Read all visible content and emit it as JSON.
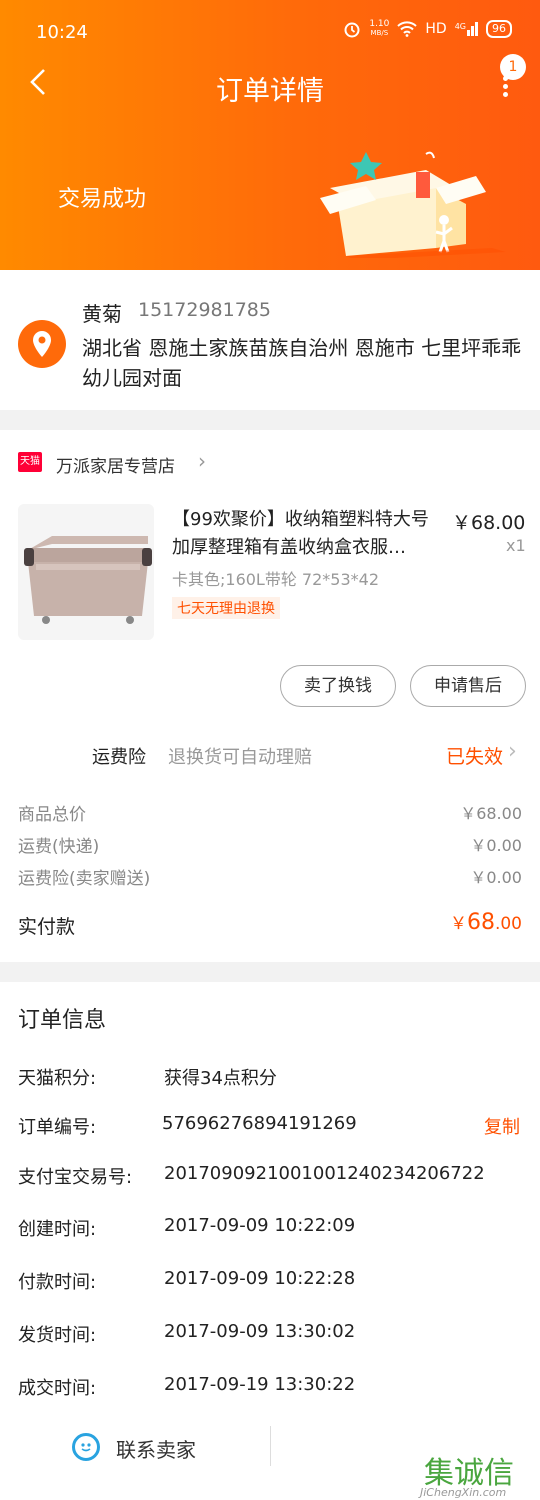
{
  "status_bar": {
    "time": "10:24",
    "speed": "1.10",
    "speed_unit": "MB/S",
    "hd": "HD",
    "signal": "4G",
    "battery": "96"
  },
  "nav": {
    "title": "订单详情",
    "badge": "1"
  },
  "header": {
    "status_text": "交易成功"
  },
  "address": {
    "name": "黄菊",
    "phone": "15172981785",
    "line": "湖北省 恩施土家族苗族自治州 恩施市 七里坪乖乖幼儿园对面"
  },
  "shop": {
    "logo_text": "天猫",
    "name": "万派家居专营店"
  },
  "product": {
    "title": "【99欢聚价】收纳箱塑料特大号加厚整理箱有盖收纳盒衣服…",
    "price": "￥68.00",
    "qty": "x1",
    "sku": "卡其色;160L带轮 72*53*42",
    "tag": "七天无理由退换"
  },
  "actions": {
    "sell": "卖了换钱",
    "after_sale": "申请售后"
  },
  "insurance": {
    "label": "运费险",
    "desc": "退换货可自动理赔",
    "status": "已失效"
  },
  "fees": [
    {
      "label": "商品总价",
      "value": "￥68.00"
    },
    {
      "label": "运费(快递)",
      "value": "￥0.00"
    },
    {
      "label": "运费险(卖家赠送)",
      "value": "￥0.00"
    }
  ],
  "total": {
    "label": "实付款",
    "currency": "￥",
    "int": "68",
    "dec": ".00"
  },
  "info": {
    "title": "订单信息",
    "rows": [
      {
        "label": "天猫积分:",
        "value": "获得34点积分"
      },
      {
        "label": "订单编号:",
        "value": "57696276894191269"
      },
      {
        "label": "支付宝交易号:",
        "value": "2017090921001001240234206722"
      },
      {
        "label": "创建时间:",
        "value": "2017-09-09 10:22:09"
      },
      {
        "label": "付款时间:",
        "value": "2017-09-09 10:22:28"
      },
      {
        "label": "发货时间:",
        "value": "2017-09-09 13:30:02"
      },
      {
        "label": "成交时间:",
        "value": "2017-09-19 13:30:22"
      }
    ],
    "copy": "复制"
  },
  "bottom": {
    "contact": "联系卖家"
  },
  "watermark": {
    "chars": "集诚信",
    "url": "JiChengXin.com"
  },
  "colors": {
    "accent": "#ff5000",
    "header_start": "#ff8a00",
    "header_end": "#ff5a0f"
  }
}
